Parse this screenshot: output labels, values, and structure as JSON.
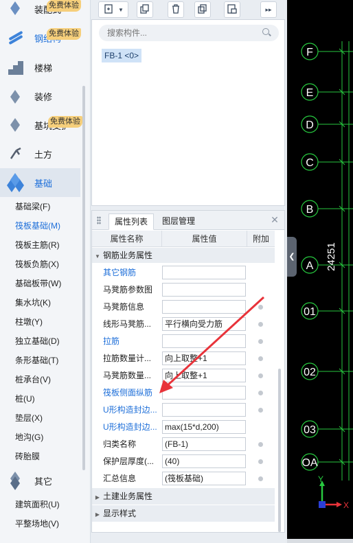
{
  "sidebar": {
    "categories": [
      {
        "label": "装配式",
        "icon": "prefab-icon"
      },
      {
        "label": "钢结构",
        "icon": "steel-icon"
      },
      {
        "label": "楼梯",
        "icon": "stair-icon"
      },
      {
        "label": "装修",
        "icon": "decoration-icon"
      },
      {
        "label": "基坑支护",
        "icon": "pit-support-icon"
      },
      {
        "label": "土方",
        "icon": "earthwork-icon"
      },
      {
        "label": "基础",
        "icon": "foundation-icon"
      },
      {
        "label": "其它",
        "icon": "other-icon"
      }
    ],
    "badge": "免费体验",
    "foundation_items": [
      "基础梁(F)",
      "筏板基础(M)",
      "筏板主筋(R)",
      "筏板负筋(X)",
      "基础板带(W)",
      "集水坑(K)",
      "柱墩(Y)",
      "独立基础(D)",
      "条形基础(T)",
      "桩承台(V)",
      "桩(U)",
      "垫层(X)",
      "地沟(G)",
      "砖胎膜"
    ],
    "selected_item": "筏板基础(M)",
    "other_items": [
      "建筑面积(U)",
      "平整场地(V)"
    ]
  },
  "toolbar": {
    "new_icon": "new-component-icon",
    "copy_icon": "copy-icon",
    "delete_icon": "delete-icon",
    "duplicate_icon": "duplicate-icon",
    "layer_copy_icon": "layer-copy-icon",
    "more_icon": "expand-more-icon"
  },
  "component_list": {
    "search_placeholder": "搜索构件...",
    "items": [
      "FB-1 <0>"
    ]
  },
  "properties": {
    "tabs": [
      "属性列表",
      "图层管理"
    ],
    "columns": [
      "属性名称",
      "属性值",
      "附加"
    ],
    "group_rebar": "钢筋业务属性",
    "rows": [
      {
        "name": "其它钢筋",
        "value": "",
        "blue": true,
        "dot": false
      },
      {
        "name": "马凳筋参数图",
        "value": "",
        "blue": false,
        "dot": false
      },
      {
        "name": "马凳筋信息",
        "value": "",
        "blue": false,
        "dot": true
      },
      {
        "name": "线形马凳筋...",
        "value": "平行横向受力筋",
        "blue": false,
        "dot": true
      },
      {
        "name": "拉筋",
        "value": "",
        "blue": true,
        "dot": true
      },
      {
        "name": "拉筋数量计...",
        "value": "向上取整+1",
        "blue": false,
        "dot": true
      },
      {
        "name": "马凳筋数量...",
        "value": "向上取整+1",
        "blue": false,
        "dot": true
      },
      {
        "name": "筏板侧面纵筋",
        "value": "",
        "blue": true,
        "dot": true
      },
      {
        "name": "U形构造封边...",
        "value": "",
        "blue": true,
        "dot": true
      },
      {
        "name": "U形构造封边...",
        "value": "max(15*d,200)",
        "blue": true,
        "dot": false
      },
      {
        "name": "归类名称",
        "value": "(FB-1)",
        "blue": false,
        "dot": true
      },
      {
        "name": "保护层厚度(...",
        "value": "(40)",
        "blue": false,
        "dot": true
      },
      {
        "name": "汇总信息",
        "value": "(筏板基础)",
        "blue": false,
        "dot": true
      }
    ],
    "group_civil": "土建业务属性",
    "group_display": "显示样式"
  },
  "cad": {
    "axes": [
      "F",
      "E",
      "D",
      "C",
      "B",
      "A",
      "01",
      "02",
      "03",
      "OA"
    ],
    "dimension": "24251",
    "ucs_x": "X",
    "ucs_y": "Y",
    "grid_color": "#27c93f",
    "axis_label_color": "#ffffff"
  },
  "colors": {
    "accent": "#1e6fd9",
    "badge": "#f6cf7b",
    "arrow": "#e8333a"
  }
}
